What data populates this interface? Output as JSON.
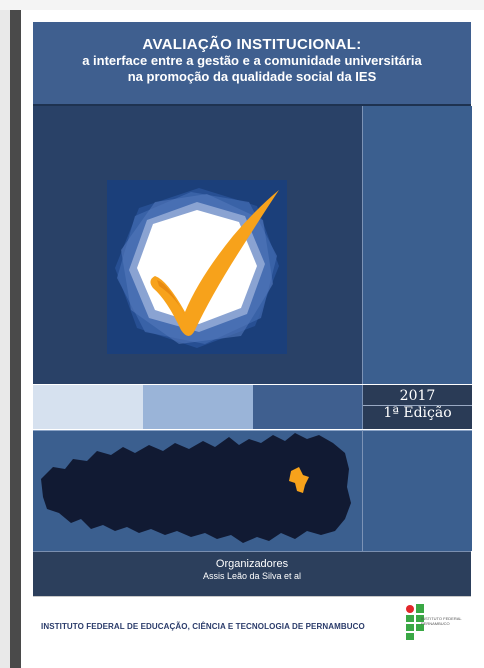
{
  "cover": {
    "title_main": "AVALIAÇÃO INSTITUCIONAL:",
    "title_sub1": "a interface entre a gestão e a comunidade universitária",
    "title_sub2": "na promoção da qualidade social da IES",
    "year": "2017",
    "edition": "1ª Edição",
    "organizers_label": "Organizadores",
    "organizers_names": "Assis Leão da Silva et al",
    "institution": "INSTITUTO FEDERAL DE EDUCAÇÃO, CIÊNCIA E TECNOLOGIA DE PERNAMBUCO",
    "logo_text": "INSTITUTO FEDERAL PERNAMBUCO"
  },
  "colors": {
    "title_bg": "#3f5f8f",
    "art_bg": "#294167",
    "check": "#f7a21b",
    "map": "#111a33",
    "highlight_region": "#f7a21b",
    "logo_green": "#3aa845",
    "logo_red": "#e2262a"
  },
  "icons": [
    "checkmark-icon",
    "map-icon",
    "ifpe-logo-icon"
  ]
}
